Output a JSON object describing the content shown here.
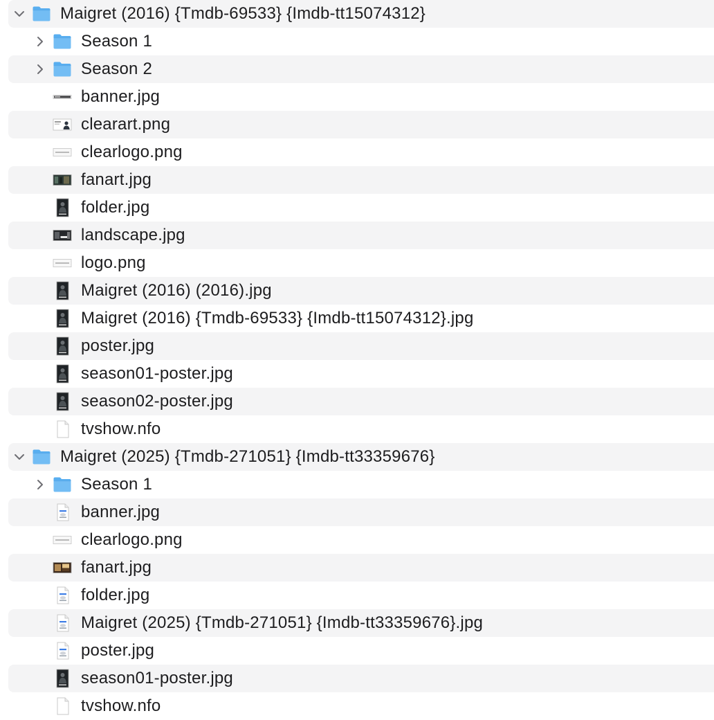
{
  "tree": [
    {
      "level": 0,
      "kind": "folder",
      "expanded": true,
      "name": "Maigret (2016) {Tmdb-69533} {Imdb-tt15074312}",
      "icon": "folder-icon"
    },
    {
      "level": 1,
      "kind": "folder",
      "expanded": false,
      "name": "Season 1",
      "icon": "folder-icon"
    },
    {
      "level": 1,
      "kind": "folder",
      "expanded": false,
      "name": "Season 2",
      "icon": "folder-icon"
    },
    {
      "level": 1,
      "kind": "file",
      "name": "banner.jpg",
      "icon": "banner-thumbnail-icon"
    },
    {
      "level": 1,
      "kind": "file",
      "name": "clearart.png",
      "icon": "clearart-thumbnail-icon"
    },
    {
      "level": 1,
      "kind": "file",
      "name": "clearlogo.png",
      "icon": "logo-thumbnail-icon"
    },
    {
      "level": 1,
      "kind": "file",
      "name": "fanart.jpg",
      "icon": "fanart-thumbnail-icon"
    },
    {
      "level": 1,
      "kind": "file",
      "name": "folder.jpg",
      "icon": "poster-thumbnail-icon"
    },
    {
      "level": 1,
      "kind": "file",
      "name": "landscape.jpg",
      "icon": "landscape-thumbnail-icon"
    },
    {
      "level": 1,
      "kind": "file",
      "name": "logo.png",
      "icon": "logo-thumbnail-icon"
    },
    {
      "level": 1,
      "kind": "file",
      "name": "Maigret (2016) (2016).jpg",
      "icon": "poster-thumbnail-icon"
    },
    {
      "level": 1,
      "kind": "file",
      "name": "Maigret (2016) {Tmdb-69533} {Imdb-tt15074312}.jpg",
      "icon": "poster-thumbnail-icon"
    },
    {
      "level": 1,
      "kind": "file",
      "name": "poster.jpg",
      "icon": "poster-thumbnail-icon"
    },
    {
      "level": 1,
      "kind": "file",
      "name": "season01-poster.jpg",
      "icon": "poster-thumbnail-icon"
    },
    {
      "level": 1,
      "kind": "file",
      "name": "season02-poster.jpg",
      "icon": "poster-thumbnail-icon"
    },
    {
      "level": 1,
      "kind": "file",
      "name": "tvshow.nfo",
      "icon": "document-icon"
    },
    {
      "level": 0,
      "kind": "folder",
      "expanded": true,
      "name": "Maigret (2025) {Tmdb-271051} {Imdb-tt33359676}",
      "icon": "folder-icon"
    },
    {
      "level": 1,
      "kind": "folder",
      "expanded": false,
      "name": "Season 1",
      "icon": "folder-icon"
    },
    {
      "level": 1,
      "kind": "file",
      "name": "banner.jpg",
      "icon": "image-file-icon"
    },
    {
      "level": 1,
      "kind": "file",
      "name": "clearlogo.png",
      "icon": "logo-thumbnail-icon"
    },
    {
      "level": 1,
      "kind": "file",
      "name": "fanart.jpg",
      "icon": "fanart-warm-thumbnail-icon"
    },
    {
      "level": 1,
      "kind": "file",
      "name": "folder.jpg",
      "icon": "image-file-icon"
    },
    {
      "level": 1,
      "kind": "file",
      "name": "Maigret (2025) {Tmdb-271051} {Imdb-tt33359676}.jpg",
      "icon": "image-file-icon"
    },
    {
      "level": 1,
      "kind": "file",
      "name": "poster.jpg",
      "icon": "image-file-icon"
    },
    {
      "level": 1,
      "kind": "file",
      "name": "season01-poster.jpg",
      "icon": "poster-thumbnail-icon"
    },
    {
      "level": 1,
      "kind": "file",
      "name": "tvshow.nfo",
      "icon": "document-icon"
    }
  ],
  "colors": {
    "stripe": "#f4f4f5",
    "folder": "#58aef0",
    "folder_tab": "#73bdf4",
    "text": "#1d1d1f",
    "chevron": "#6e6e73"
  }
}
